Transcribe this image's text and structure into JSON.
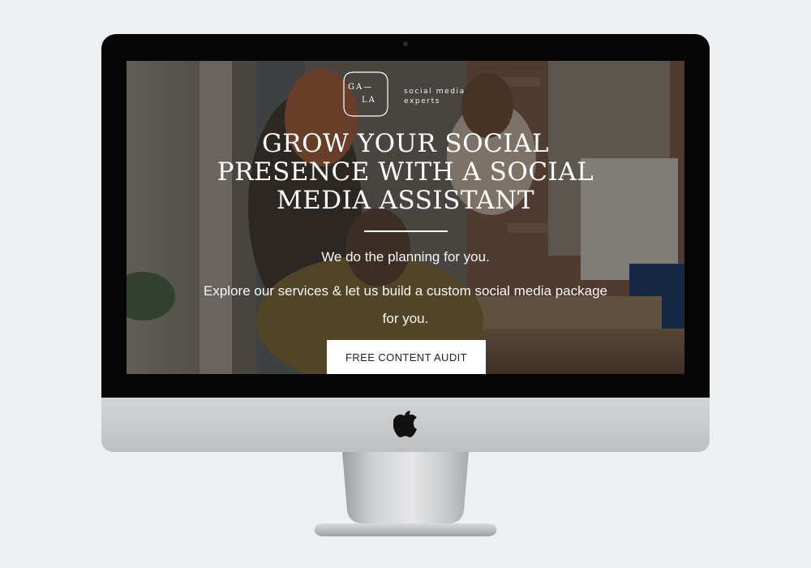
{
  "brand": {
    "logo_top": "GA—",
    "logo_bottom": "LA",
    "tagline_line1": "social media",
    "tagline_line2": "experts"
  },
  "hero": {
    "headline_line1": "GROW YOUR SOCIAL",
    "headline_line2": "PRESENCE WITH A SOCIAL",
    "headline_line3": "MEDIA ASSISTANT",
    "subline1": "We do the planning for you.",
    "subline2": "Explore our services & let us build a custom social media package for you.",
    "cta_label": "FREE CONTENT AUDIT"
  },
  "device": {
    "logo_icon": "apple-logo-icon",
    "bezel_color": "#050505",
    "body_color": "#c9cbcd",
    "background_color": "#ecf0f2"
  }
}
